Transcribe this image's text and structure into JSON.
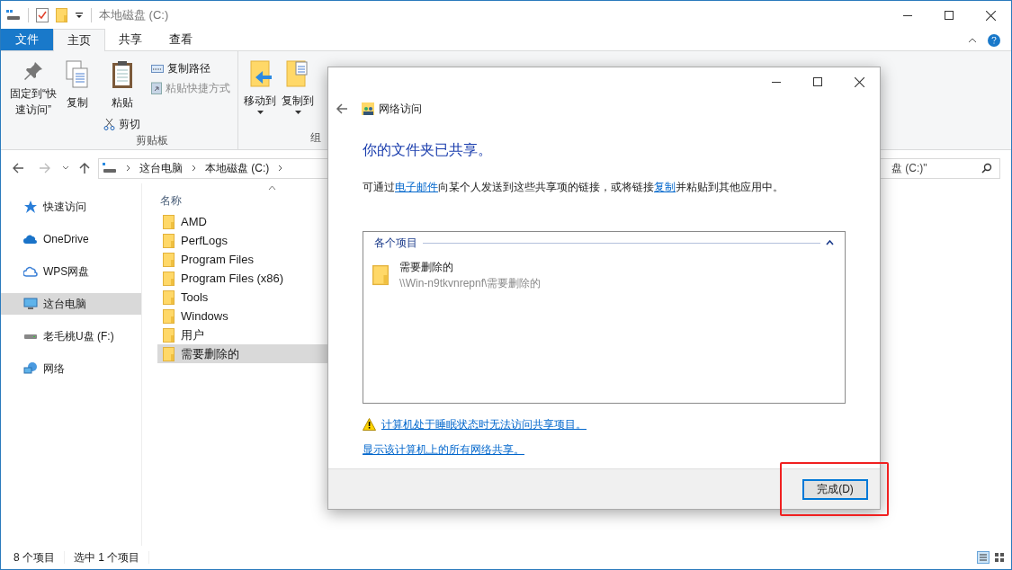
{
  "window": {
    "title": "本地磁盘 (C:)"
  },
  "ribbon_tabs": [
    {
      "label": "文件",
      "kind": "file",
      "selected": false
    },
    {
      "label": "主页",
      "kind": "tab",
      "selected": true
    },
    {
      "label": "共享",
      "kind": "tab",
      "selected": false
    },
    {
      "label": "查看",
      "kind": "tab",
      "selected": false
    }
  ],
  "clipboard_group": {
    "pin": [
      "固定到“快",
      "速访问”"
    ],
    "copy": "复制",
    "paste": "粘贴",
    "copy_path": "复制路径",
    "paste_shortcut": {
      "label": "粘贴快捷方式",
      "disabled": true
    },
    "cut": "剪切",
    "label": "剪贴板"
  },
  "organize_group": {
    "move_to": "移动到",
    "copy_to": "复制到",
    "label": "组"
  },
  "address": {
    "crumbs": [
      "这台电脑",
      "本地磁盘 (C:)"
    ],
    "search_placeholder": "盘 (C:)\""
  },
  "sidebar": [
    {
      "label": "快速访问",
      "kind": "star",
      "selected": false
    },
    {
      "label": "OneDrive",
      "kind": "cloud",
      "selected": false
    },
    {
      "label": "WPS网盘",
      "kind": "cloud-outline",
      "selected": false
    },
    {
      "label": "这台电脑",
      "kind": "pc",
      "selected": true
    },
    {
      "label": "老毛桃U盘 (F:)",
      "kind": "drive",
      "selected": false
    },
    {
      "label": "网络",
      "kind": "network",
      "selected": false
    }
  ],
  "files": {
    "column": "名称",
    "rows": [
      {
        "name": "AMD",
        "selected": false
      },
      {
        "name": "PerfLogs",
        "selected": false
      },
      {
        "name": "Program Files",
        "selected": false
      },
      {
        "name": "Program Files (x86)",
        "selected": false
      },
      {
        "name": "Tools",
        "selected": false
      },
      {
        "name": "Windows",
        "selected": false
      },
      {
        "name": "用户",
        "selected": false
      },
      {
        "name": "需要删除的",
        "selected": true
      }
    ]
  },
  "status_bar": {
    "count": "8 个项目",
    "selection": "选中 1 个项目"
  },
  "dialog": {
    "title": "网络访问",
    "heading": "你的文件夹已共享。",
    "description": [
      {
        "kind": "text",
        "text": "可通过"
      },
      {
        "kind": "link",
        "text": "电子邮件"
      },
      {
        "kind": "text",
        "text": "向某个人发送到这些共享项的链接，或将链接"
      },
      {
        "kind": "link",
        "text": "复制"
      },
      {
        "kind": "text",
        "text": "并粘贴到其他应用中。"
      }
    ],
    "items_header": "各个项目",
    "expanded": true,
    "items": [
      {
        "name": "需要删除的",
        "path": "\\\\Win-n9tkvnrepnf\\需要删除的"
      }
    ],
    "warning_link": "计算机处于睡眠状态时无法访问共享项目。",
    "show_all_link": "显示该计算机上的所有网络共享。",
    "done_button": "完成(D)",
    "highlighted": true
  }
}
